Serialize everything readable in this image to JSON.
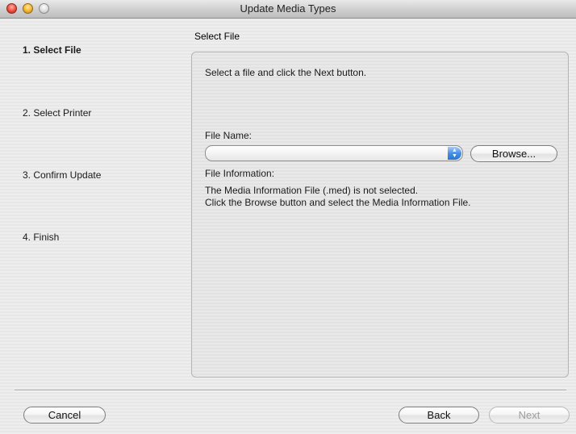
{
  "window": {
    "title": "Update Media Types"
  },
  "steps": [
    {
      "label": "1. Select File",
      "active": true
    },
    {
      "label": "2. Select Printer",
      "active": false
    },
    {
      "label": "3. Confirm Update",
      "active": false
    },
    {
      "label": "4. Finish",
      "active": false
    }
  ],
  "panel": {
    "title": "Select File",
    "instruction": "Select a file and click the Next button.",
    "file_name_label": "File Name:",
    "file_name_value": "",
    "browse_label": "Browse...",
    "file_info_label": "File Information:",
    "file_info_line1": "The Media Information File (.med) is not selected.",
    "file_info_line2": "Click the Browse button and select the Media Information File."
  },
  "footer": {
    "cancel_label": "Cancel",
    "back_label": "Back",
    "next_label": "Next"
  },
  "colors": {
    "accent": "#2b70d6",
    "disabled_text": "#9e9e9e"
  }
}
